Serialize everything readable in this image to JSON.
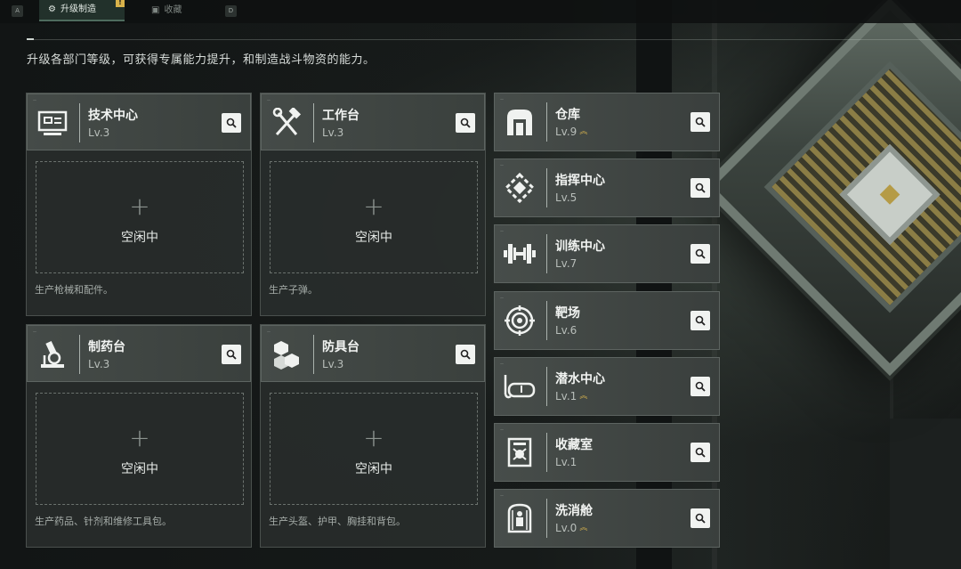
{
  "tabs": {
    "key_left": "A",
    "key_right": "D",
    "upgrade_label": "升级制造",
    "upgrade_badge": "!",
    "collection_label": "收藏"
  },
  "subtitle": "升级各部门等级，可获得专属能力提升，和制造战斗物资的能力。",
  "production_facilities": [
    {
      "name": "技术中心",
      "level": "Lv.3",
      "icon": "computer-chip-icon",
      "slot_status": "空闲中",
      "description": "生产枪械和配件。"
    },
    {
      "name": "工作台",
      "level": "Lv.3",
      "icon": "hammer-wrench-icon",
      "slot_status": "空闲中",
      "description": "生产子弹。"
    },
    {
      "name": "制药台",
      "level": "Lv.3",
      "icon": "microscope-icon",
      "slot_status": "空闲中",
      "description": "生产药品、针剂和维修工具包。"
    },
    {
      "name": "防具台",
      "level": "Lv.3",
      "icon": "armor-cubes-icon",
      "slot_status": "空闲中",
      "description": "生产头盔、护甲、胸挂和背包。"
    }
  ],
  "side_facilities": [
    {
      "name": "仓库",
      "level": "Lv.9",
      "icon": "warehouse-icon",
      "upgradable": true
    },
    {
      "name": "指挥中心",
      "level": "Lv.5",
      "icon": "command-center-icon",
      "upgradable": false
    },
    {
      "name": "训练中心",
      "level": "Lv.7",
      "icon": "dumbbell-icon",
      "upgradable": false
    },
    {
      "name": "靶场",
      "level": "Lv.6",
      "icon": "target-icon",
      "upgradable": false
    },
    {
      "name": "潜水中心",
      "level": "Lv.1",
      "icon": "diving-mask-icon",
      "upgradable": true
    },
    {
      "name": "收藏室",
      "level": "Lv.1",
      "icon": "collection-case-icon",
      "upgradable": false
    },
    {
      "name": "洗消舱",
      "level": "Lv.0",
      "icon": "decontamination-pod-icon",
      "upgradable": true
    }
  ],
  "colors": {
    "upgrade_arrow": "#d6b24e",
    "active_tab": "#22312b",
    "badge": "#d9b24a"
  }
}
